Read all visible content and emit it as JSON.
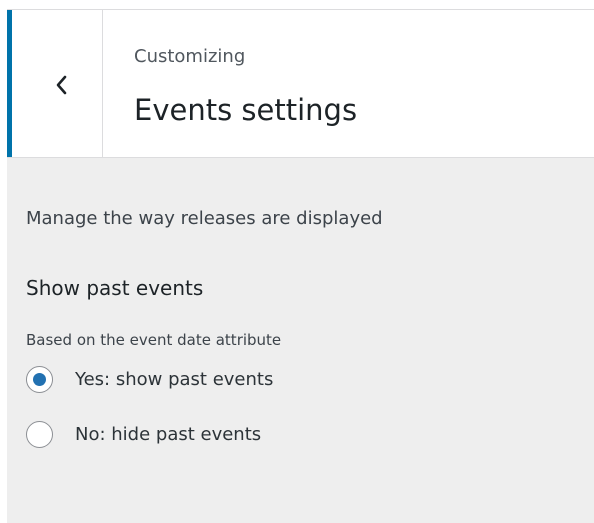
{
  "header": {
    "eyebrow": "Customizing",
    "title": "Events settings",
    "back_icon": "chevron-left-icon",
    "accent_color": "#0073aa"
  },
  "section": {
    "description": "Manage the way releases are displayed",
    "setting": {
      "heading": "Show past events",
      "hint": "Based on the event date attribute",
      "options": [
        {
          "label": "Yes: show past events",
          "checked": true
        },
        {
          "label": "No: hide past events",
          "checked": false
        }
      ],
      "radio_color": "#2271b1"
    }
  }
}
